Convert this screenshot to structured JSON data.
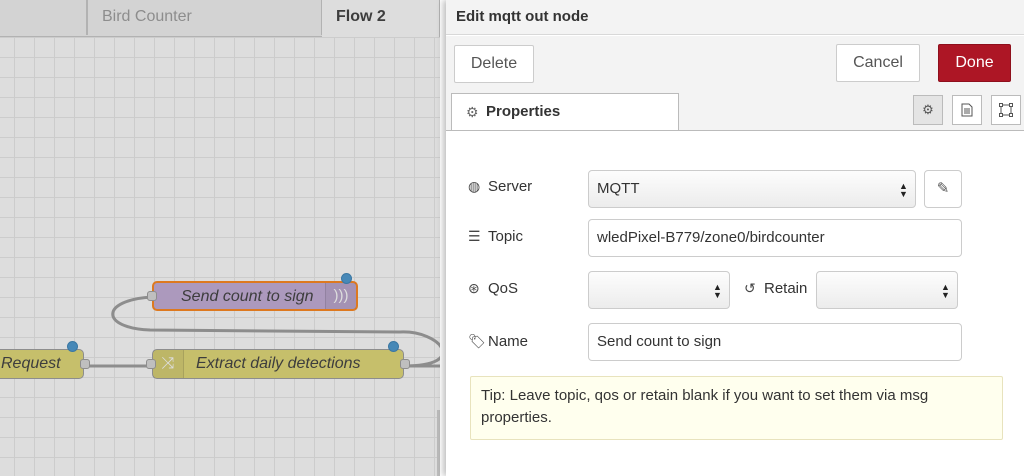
{
  "workspace": {
    "tabs": [
      {
        "label": ""
      },
      {
        "label": "Bird Counter"
      },
      {
        "label": "Flow 2"
      }
    ],
    "nodes": {
      "send": "Send count to sign",
      "extract": "Extract daily detections",
      "request": "Request"
    }
  },
  "tray": {
    "title": "Edit mqtt out node",
    "delete_label": "Delete",
    "cancel_label": "Cancel",
    "done_label": "Done",
    "properties_tab": "Properties",
    "fields": {
      "server_label": "Server",
      "server_value": "MQTT",
      "topic_label": "Topic",
      "topic_value": "wledPixel-B779/zone0/birdcounter",
      "qos_label": "QoS",
      "qos_value": "",
      "retain_label": "Retain",
      "retain_value": "",
      "name_label": "Name",
      "name_value": "Send count to sign"
    },
    "tip": "Tip: Leave topic, qos or retain blank if you want to set them via msg properties."
  },
  "colors": {
    "done_button": "#ad1625",
    "send_node": "#c0a8d6",
    "function_node": "#e2d96e",
    "status_dot": "#3f93cf",
    "tip_background": "#ffffee"
  },
  "icons": {
    "server": "globe-icon",
    "topic": "tasks-icon",
    "qos": "asterisk-icon",
    "retain": "history-icon",
    "name": "tag-icon",
    "edit": "pencil-icon"
  }
}
